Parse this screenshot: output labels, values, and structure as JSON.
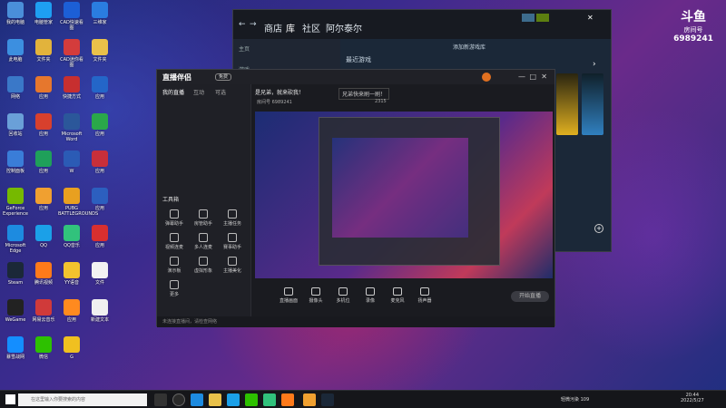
{
  "desktop_icons": [
    {
      "label": "我的电脑",
      "color": "#4a8fd9"
    },
    {
      "label": "电脑管家",
      "color": "#1e9ff2"
    },
    {
      "label": "CAD快速看图",
      "color": "#1c5fd6"
    },
    {
      "label": "三维家",
      "color": "#2a7de0"
    },
    {
      "label": "此电脑",
      "color": "#3c8fe0"
    },
    {
      "label": "文件夹",
      "color": "#e2b33c"
    },
    {
      "label": "CAD迷你看图",
      "color": "#d43c3c"
    },
    {
      "label": "文件夹",
      "color": "#e9c14a"
    },
    {
      "label": "网络",
      "color": "#3a78c8"
    },
    {
      "label": "应用",
      "color": "#e6772d"
    },
    {
      "label": "快捷方式",
      "color": "#c72f2f"
    },
    {
      "label": "应用",
      "color": "#2466c8"
    },
    {
      "label": "回收站",
      "color": "#6aa0d8"
    },
    {
      "label": "应用",
      "color": "#d8402d"
    },
    {
      "label": "Microsoft Word",
      "color": "#2b579a"
    },
    {
      "label": "应用",
      "color": "#2aa84a"
    },
    {
      "label": "控制面板",
      "color": "#3a7dd8"
    },
    {
      "label": "应用",
      "color": "#1fa05a"
    },
    {
      "label": "W",
      "color": "#2b5bb5"
    },
    {
      "label": "应用",
      "color": "#c82f3a"
    },
    {
      "label": "GeForce Experience",
      "color": "#76b900"
    },
    {
      "label": "应用",
      "color": "#f0a030"
    },
    {
      "label": "PUBG BATTLEGROUNDS",
      "color": "#e8a020"
    },
    {
      "label": "应用",
      "color": "#2c5fbf"
    },
    {
      "label": "Microsoft Edge",
      "color": "#1d8be0"
    },
    {
      "label": "QQ",
      "color": "#1ba0e8"
    },
    {
      "label": "QQ音乐",
      "color": "#31c27c"
    },
    {
      "label": "应用",
      "color": "#d82f2f"
    },
    {
      "label": "Steam",
      "color": "#1b2838"
    },
    {
      "label": "腾讯视频",
      "color": "#ff7a1a"
    },
    {
      "label": "YY语音",
      "color": "#f2c22e"
    },
    {
      "label": "文件",
      "color": "#f2f2f2"
    },
    {
      "label": "WeGame",
      "color": "#222"
    },
    {
      "label": "网易云音乐",
      "color": "#d03a3a"
    },
    {
      "label": "应用",
      "color": "#ff8a1f"
    },
    {
      "label": "新建文本",
      "color": "#f0f0f0"
    },
    {
      "label": "暴雪战网",
      "color": "#148eff"
    },
    {
      "label": "微信",
      "color": "#2dc100"
    },
    {
      "label": "G",
      "color": "#f0c020"
    }
  ],
  "watermark": {
    "line1": "斗鱼",
    "line2": "房间号",
    "room": "6989241"
  },
  "steam": {
    "tabs": [
      "商店",
      "库",
      "社区",
      "阿尔泰尔"
    ],
    "home": "主页",
    "recent": "最近游戏",
    "add_shelf": "添加新游戏库",
    "collection": "游戏"
  },
  "streamer": {
    "app_name": "直播伴侣",
    "tag": "免费",
    "left_tabs": [
      "我的直播",
      "互动",
      "可选"
    ],
    "tool_header": "工具箱",
    "tools": [
      "弹幕助手",
      "房管助手",
      "主播任务",
      "视频连麦",
      "多人连麦",
      "赛事助手",
      "演示板",
      "虚拟形象",
      "主播美化",
      "更多"
    ],
    "announce": "是兄弟，就来砍我！",
    "room_title": "兄弟快来刷一刷！",
    "room_id": "房间号 6989241",
    "stats": "2315",
    "fans": "88",
    "bottom_tools": [
      "直播画面",
      "摄像头",
      "多机位",
      "录像",
      "麦克风",
      "扬声器"
    ],
    "start_button": "开始直播",
    "status_items": [
      "CPU占用",
      "内存",
      "帧率",
      "码率",
      "丢帧"
    ],
    "status_text": "未连接直播间，请检查网络"
  },
  "taskbar": {
    "search_placeholder": "在这里输入你要搜索的内容",
    "time": "20:44",
    "date": "2022/5/27",
    "right_label": "轻微污染 109"
  }
}
